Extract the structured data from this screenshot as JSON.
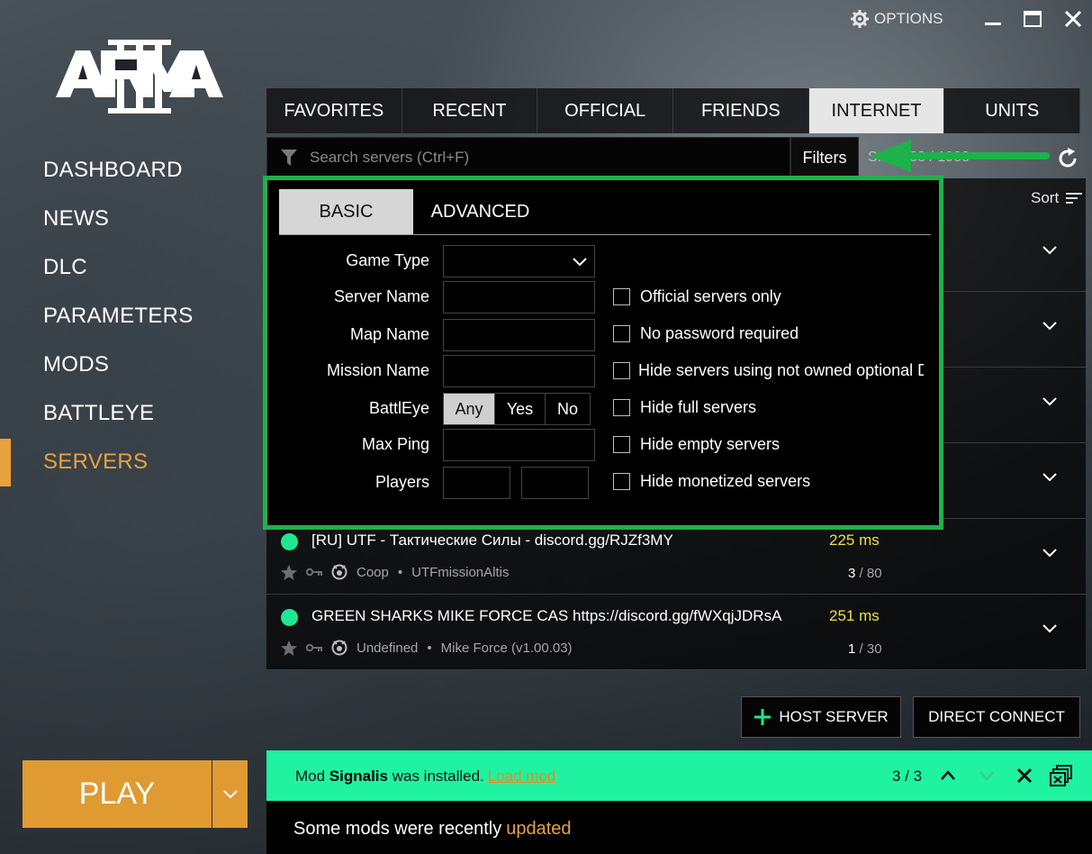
{
  "window": {
    "options_label": "OPTIONS"
  },
  "logo": {
    "text": "ARMA III"
  },
  "nav": {
    "items": [
      "DASHBOARD",
      "NEWS",
      "DLC",
      "PARAMETERS",
      "MODS",
      "BATTLEYE",
      "SERVERS"
    ],
    "active": "SERVERS"
  },
  "play": {
    "label": "PLAY"
  },
  "tabs": [
    "FAVORITES",
    "RECENT",
    "OFFICIAL",
    "FRIENDS",
    "INTERNET",
    "UNITS"
  ],
  "active_tab": "INTERNET",
  "search": {
    "placeholder": "Search servers (Ctrl+F)",
    "filters_label": "Filters",
    "count_text": "S... 1988 / 1988"
  },
  "sort_label": "Sort",
  "filters": {
    "tabs": [
      "BASIC",
      "ADVANCED"
    ],
    "labels": {
      "game_type": "Game Type",
      "server_name": "Server Name",
      "map_name": "Map Name",
      "mission_name": "Mission Name",
      "battleye": "BattlEye",
      "max_ping": "Max Ping",
      "players": "Players"
    },
    "battleye_options": [
      "Any",
      "Yes",
      "No"
    ],
    "checkboxes": [
      "Official servers only",
      "No password required",
      "Hide servers using not owned optional D",
      "Hide full servers",
      "Hide empty servers",
      "Hide monetized servers"
    ]
  },
  "servers": [
    {
      "name": "[RU] UTF - Тактические Силы - discord.gg/RJZf3MY",
      "ping": "225 ms",
      "type": "Coop",
      "mission": "UTFmissionAltis",
      "players_current": "3",
      "players_max": " / 80"
    },
    {
      "name": "GREEN SHARKS MIKE FORCE CAS https://discord.gg/fWXqjJDRsA",
      "ping": "251 ms",
      "type": "Undefined",
      "mission": "Mike Force (v1.00.03)",
      "players_current": "1",
      "players_max": " / 30"
    }
  ],
  "buttons": {
    "host_server": "HOST SERVER",
    "direct_connect": "DIRECT CONNECT"
  },
  "notification": {
    "prefix": "Mod ",
    "mod_name": "Signalis",
    "suffix": " was installed.",
    "link": "Load mod",
    "count": "3 / 3"
  },
  "footer": {
    "text": "Some mods were recently",
    "highlight": "updated"
  },
  "colors": {
    "accent": "#e8a23c",
    "highlight_green": "#1db24a",
    "notification_bg": "#1ff2a0",
    "ping_yellow": "#f0e13a",
    "online_dot": "#1de891"
  }
}
